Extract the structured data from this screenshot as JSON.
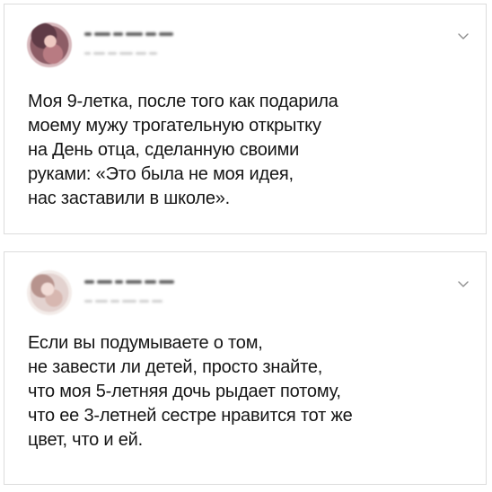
{
  "tweets": [
    {
      "text_lines": [
        "Моя 9-летка, после того как подарила",
        "моему мужу трогательную открытку",
        "на День отца, сделанную своими",
        "руками: «Это была не моя идея,",
        "нас заставили в школе»."
      ],
      "menu_icon": "chevron-down-icon"
    },
    {
      "text_lines": [
        "Если вы подумываете о том,",
        "не завести ли детей, просто знайте,",
        "что моя 5-летняя дочь рыдает потому,",
        "что ее 3-летней сестре нравится тот же",
        "цвет, что и ей."
      ],
      "menu_icon": "chevron-down-icon"
    }
  ]
}
